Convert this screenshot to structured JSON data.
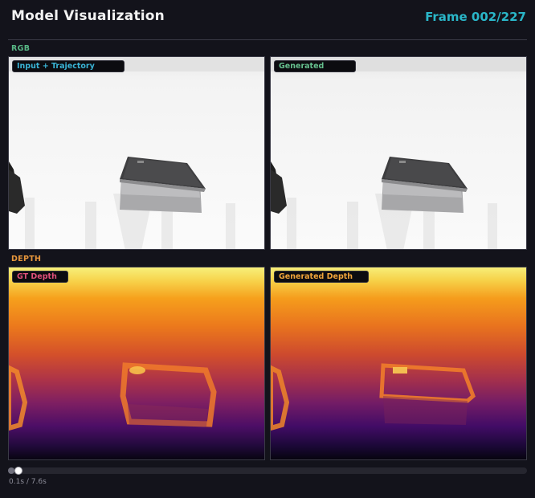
{
  "header": {
    "title": "Model Visualization",
    "frame_label": "Frame 002/227"
  },
  "sections": {
    "rgb_label": "RGB",
    "depth_label": "DEPTH"
  },
  "panels": {
    "input": {
      "label": "Input + Trajectory"
    },
    "generated": {
      "label": "Generated"
    },
    "gt_depth": {
      "label": "GT Depth"
    },
    "generated_depth": {
      "label": "Generated Depth"
    }
  },
  "timeline": {
    "progress": 0.013,
    "readout": "0.1s / 7.6s"
  },
  "colors": {
    "accent": "#2ab6c8",
    "rgb_section": "#58b785",
    "depth_section": "#e6963c",
    "input_tag": "#3ab4d6",
    "generated_tag": "#66c08e",
    "gt_depth_tag": "#e0507a",
    "generated_depth_tag": "#f0a43a"
  }
}
